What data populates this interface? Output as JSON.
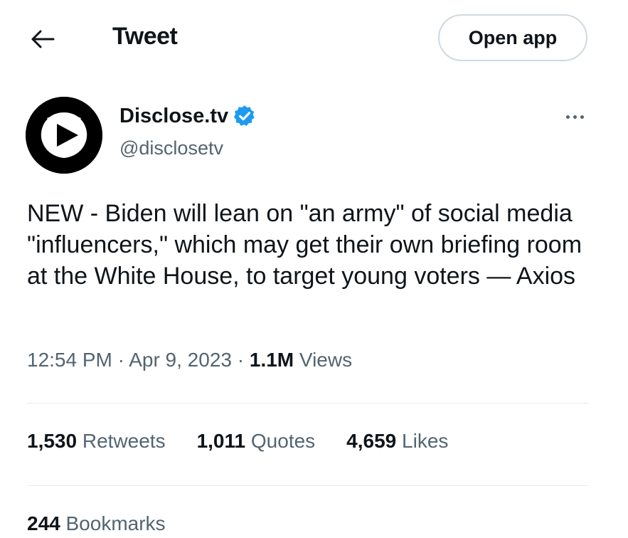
{
  "header": {
    "back_icon": "arrow-left-icon",
    "title": "Tweet",
    "open_app_label": "Open app"
  },
  "author": {
    "display_name": "Disclose.tv",
    "handle": "@disclosetv",
    "verified": true,
    "verified_color": "#1d9bf0",
    "avatar_icon": "play-logo-icon"
  },
  "tweet": {
    "text": "NEW - Biden will lean on \"an army\" of social media \"influencers,\" which may get their own briefing room at the White House, to target young voters — Axios"
  },
  "meta": {
    "time": "12:54 PM",
    "separator": "·",
    "date": "Apr 9, 2023",
    "views_count": "1.1M",
    "views_label": "Views"
  },
  "stats": {
    "retweets_count": "1,530",
    "retweets_label": "Retweets",
    "quotes_count": "1,011",
    "quotes_label": "Quotes",
    "likes_count": "4,659",
    "likes_label": "Likes",
    "bookmarks_count": "244",
    "bookmarks_label": "Bookmarks"
  },
  "colors": {
    "text_primary": "#0f1419",
    "text_secondary": "#536471",
    "border": "#cfd9de",
    "divider": "#e6ecf0"
  }
}
